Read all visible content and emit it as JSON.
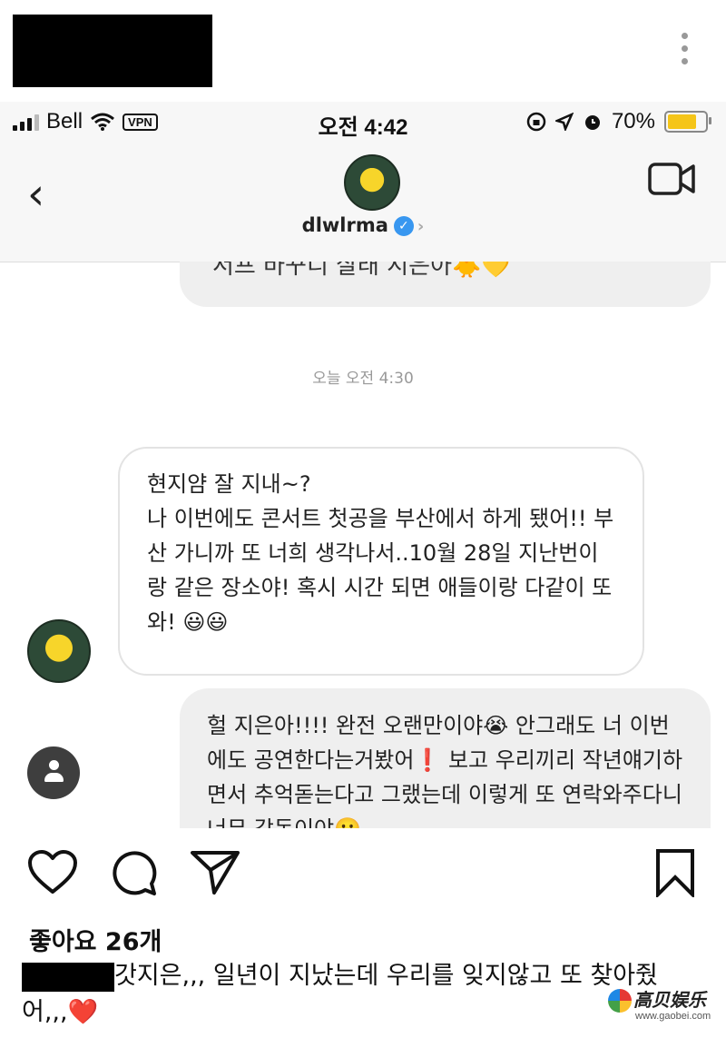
{
  "status_bar": {
    "carrier": "Bell",
    "vpn": "VPN",
    "time": "오전 4:42",
    "battery": "70%",
    "battery_level": 0.7
  },
  "chat": {
    "username": "dlwlrma",
    "prev_message_fragment": "서프 바꾸디 살래 시은아🐥💛",
    "timestamp": "오늘 오전 4:30",
    "incoming": [
      "현지얌 잘 지내~?",
      "나 이번에도 콘서트 첫공을 부산에서 하게 됐어!! 부산 가니까 또 너희 생각나서..10월 28일 지난번이랑 같은 장소야! 혹시 시간 되면 애들이랑 다같이 또 와! 😃😃"
    ],
    "outgoing": "헐 지은아!!!! 완전 오랜만이야😭 안그래도 너 이번에도 공연한다는거봤어❗ 보고 우리끼리 작년얘기하면서 추억돋는다고 그랬는데 이렇게 또 연락와주다니 너무 감동이야🥲"
  },
  "post": {
    "likes": "좋아요 26개",
    "caption": "갓지은,,, 일년이 지났는데 우리를 잊지않고 또 찾아줬어,,,❤️"
  },
  "watermark": {
    "name": "高贝娱乐",
    "url": "www.gaobei.com"
  },
  "colors": {
    "verified": "#3897f0",
    "bubble_out": "#efefef",
    "battery": "#f5c518"
  }
}
